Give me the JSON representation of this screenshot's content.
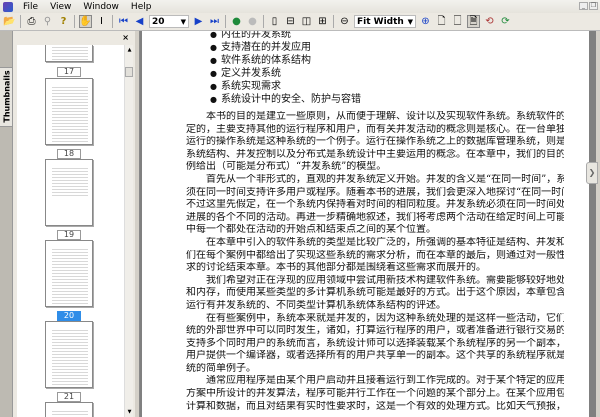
{
  "menu": {
    "items": [
      "File",
      "View",
      "Window",
      "Help"
    ]
  },
  "toolbar": {
    "page_number": "20",
    "zoom": "Fit Width"
  },
  "sidebar": {
    "tab_label": "Thumbnails",
    "close": "×",
    "thumbnails": [
      {
        "label": "17"
      },
      {
        "label": "18"
      },
      {
        "label": "19"
      },
      {
        "label": "20",
        "selected": true
      },
      {
        "label": "21"
      }
    ]
  },
  "document": {
    "bullets": [
      "内在的并发系统",
      "支持潜在的并发应用",
      "软件系统的体系结构",
      "定义并发系统",
      "系统实现需求",
      "系统设计中的安全、防护与容错"
    ],
    "lines": [
      {
        "t": "本书的目的是建立一些原则，从而便于理解、设计以及实现软件系统。系统软件的运行是不确",
        "ind": true
      },
      {
        "t": "定的，主要支持其他的运行程序和用户，而有关并发活动的概念则是核心。在一台单独的计算机上"
      },
      {
        "t": "运行的操作系统是这种系统的一个例子。运行在操作系统之上的数据库管理系统，则是另一种例子。"
      },
      {
        "t": "系统结构、并发控制以及分布式是系统设计中主要运用的概念。在本章中，我们的目的在于通过示"
      },
      {
        "t": "例给出（可能是分布式）“并发系统”的模型。",
        "end": true
      },
      {
        "t": "首先从一个非形式的，直观的并发系统定义开始。并发的含义是“在同一时间”，系统软件必",
        "ind": true
      },
      {
        "t": "须在同一时间支持许多用户或程序。随着本书的进展，我们会更深入地探讨“在同一时间”的含义。"
      },
      {
        "t": "不过这里先假定，在一个系统内保持着对时间的相同粒度。并发系统必须在同一时间处理正在取得"
      },
      {
        "t": "进展的各个不同的活动。再进一步精确地叙述，我们将考虑两个活动在给定时间上可能的并发，其"
      },
      {
        "t": "中每一个都处在活动的开始点和结束点之间的某个位置。",
        "end": true
      },
      {
        "t": "在本章中引入的软件系统的类型是比较广泛的，所强调的基本特征是结构、并发和分布式。我",
        "ind": true
      },
      {
        "t": "们在每个案例中都给出了实现这些系统的需求分析，而在本章的最后，则通过对一般性并发系统需"
      },
      {
        "t": "求的讨论结束本章。本书的其他部分都是围绕着这些需求而展开的。",
        "end": true
      },
      {
        "t": "我们希望对正在浮现的应用领域中尝试用新技术构建软件系统。需要能够较好地处理运算能力",
        "ind": true
      },
      {
        "t": "和内存，而使用某些类型的多计算机系统可能是最好的方式。出于这个原因，本章包含了一个对可"
      },
      {
        "t": "运行有并发系统的、不同类型计算机系统体系结构的评述。",
        "end": true
      },
      {
        "t": "在有些案例中，系统本来就是并发的，因为这种系统处理的是这样一些活动，它们在计算机系",
        "ind": true
      },
      {
        "t": "统的外部世界中可以同时发生，诸如，打算运行程序的用户，或者准备进行银行交易的客户。对于"
      },
      {
        "t": "支持多个同时用户的系统而言，系统设计师可以选择装载某个系统程序的另一个副本，诸如为每个"
      },
      {
        "t": "用户提供一个编译器，或者选择所有的用户共享单一的副本。这个共享的系统程序就是一个并发系"
      },
      {
        "t": "统的简单例子。",
        "end": true
      },
      {
        "t": "通常应用程序是由某个用户启动并且接着运行到工作完成的。对于某个特定的应用，通过解决",
        "ind": true
      },
      {
        "t": "方案中所设计的并发算法，程序可能并行工作在一个问题的某个部分上。在某个应用包含了大量的"
      },
      {
        "t": "计算和数据，而且对结果有实时性要求时，这是一个有效的处理方式。比如天气预报，这类例子都"
      }
    ]
  }
}
